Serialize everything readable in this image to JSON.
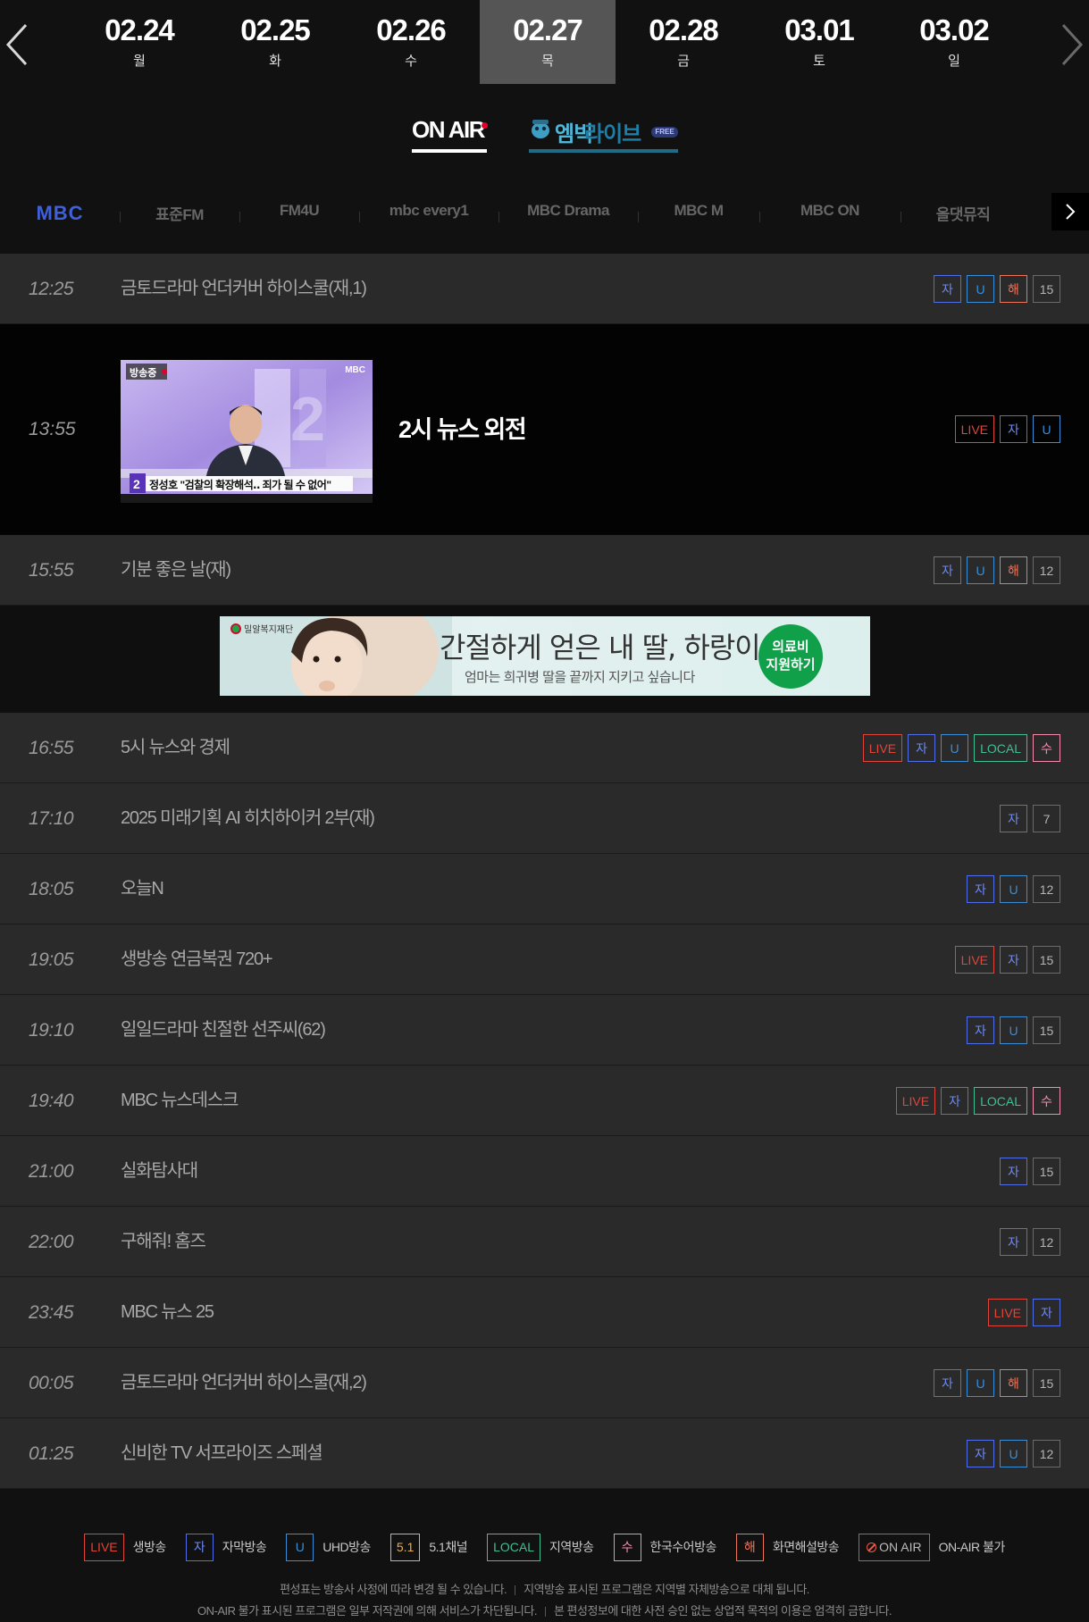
{
  "dates": [
    {
      "date": "02.24",
      "day": "월"
    },
    {
      "date": "02.25",
      "day": "화"
    },
    {
      "date": "02.26",
      "day": "수"
    },
    {
      "date": "02.27",
      "day": "목"
    },
    {
      "date": "02.28",
      "day": "금"
    },
    {
      "date": "03.01",
      "day": "토"
    },
    {
      "date": "03.02",
      "day": "일"
    }
  ],
  "active_date": "02.27",
  "tabs": {
    "onair": "ON AIR",
    "live_part1": "엠빅",
    "live_part2": "라이브",
    "live_badge": "FREE"
  },
  "channels": [
    {
      "label": "MBC"
    },
    {
      "label": "표준FM"
    },
    {
      "label": "FM4U"
    },
    {
      "label": "mbc every1"
    },
    {
      "label": "MBC Drama"
    },
    {
      "label": "MBC M"
    },
    {
      "label": "MBC ON"
    },
    {
      "label": "올댓뮤직"
    }
  ],
  "schedule": [
    {
      "time": "12:25",
      "title": "금토드라마 언더커버 하이스쿨(재,1)",
      "badges": [
        "자",
        "U",
        "해",
        "15"
      ]
    },
    {
      "time": "13:55",
      "title": "2시 뉴스 외전",
      "on_air": true,
      "badges": [
        "LIVE",
        "자",
        "U"
      ],
      "thumb_label": "방송중",
      "thumb_caption": "정성호 \"검찰의 확장해석‥ 죄가 될 수 없어\"",
      "thumb_logo": "MBC"
    },
    {
      "time": "15:55",
      "title": "기분 좋은 날(재)",
      "badges": [
        "자",
        "U",
        "해",
        "12"
      ]
    },
    {
      "time": "16:55",
      "title": "5시 뉴스와 경제",
      "badges": [
        "LIVE",
        "자",
        "U",
        "LOCAL",
        "수"
      ]
    },
    {
      "time": "17:10",
      "title": "2025 미래기획 AI 히치하이커 2부(재)",
      "badges": [
        "자",
        "7"
      ]
    },
    {
      "time": "18:05",
      "title": "오늘N",
      "badges": [
        "자",
        "U",
        "12"
      ]
    },
    {
      "time": "19:05",
      "title": "생방송 연금복권 720+",
      "badges": [
        "LIVE",
        "자",
        "15"
      ]
    },
    {
      "time": "19:10",
      "title": "일일드라마 친절한 선주씨(62)",
      "badges": [
        "자",
        "U",
        "15"
      ]
    },
    {
      "time": "19:40",
      "title": "MBC 뉴스데스크",
      "badges": [
        "LIVE",
        "자",
        "LOCAL",
        "수"
      ]
    },
    {
      "time": "21:00",
      "title": "실화탐사대",
      "badges": [
        "자",
        "15"
      ]
    },
    {
      "time": "22:00",
      "title": "구해줘! 홈즈",
      "badges": [
        "자",
        "12"
      ]
    },
    {
      "time": "23:45",
      "title": "MBC 뉴스 25",
      "badges": [
        "LIVE",
        "자"
      ]
    },
    {
      "time": "00:05",
      "title": "금토드라마 언더커버 하이스쿨(재,2)",
      "badges": [
        "자",
        "U",
        "해",
        "15"
      ]
    },
    {
      "time": "01:25",
      "title": "신비한 TV 서프라이즈 스페셜",
      "badges": [
        "자",
        "U",
        "12"
      ]
    }
  ],
  "ad": {
    "org": "밀알복지재단",
    "headline": "간절하게 얻은 내 딸, 하랑이",
    "sub": "엄마는 희귀병 딸을 끝까지 지키고 싶습니다",
    "cta_line1": "의료비",
    "cta_line2": "지원하기"
  },
  "legend": [
    {
      "badge": "LIVE",
      "label": "생방송"
    },
    {
      "badge": "자",
      "label": "자막방송"
    },
    {
      "badge": "U",
      "label": "UHD방송"
    },
    {
      "badge": "5.1",
      "label": "5.1채널"
    },
    {
      "badge": "LOCAL",
      "label": "지역방송"
    },
    {
      "badge": "수",
      "label": "한국수어방송"
    },
    {
      "badge": "해",
      "label": "화면해설방송"
    },
    {
      "badge": "ON AIR",
      "label": "ON-AIR 불가"
    }
  ],
  "notes": {
    "line1_a": "편성표는 방송사 사정에 따라 변경 될 수 있습니다.",
    "line1_b": "지역방송 표시된 프로그램은 지역별 자체방송으로 대체 됩니다.",
    "line2_a": "ON-AIR 불가 표시된 프로그램은 일부 저작권에 의해 서비스가 차단됩니다.",
    "line2_b": "본 편성정보에 대한 사전 승인 없는 상업적 목적의 이용은 엄격히 금합니다."
  },
  "colors": {
    "live": "#e0443a",
    "caption": "#4f6ee8",
    "uhd": "#3a8ed8",
    "audio_desc": "#f0745a",
    "local": "#3fbf93",
    "sign": "#f48cab",
    "surround": "#e8b04b",
    "mbc_blue": "#4060d9"
  }
}
